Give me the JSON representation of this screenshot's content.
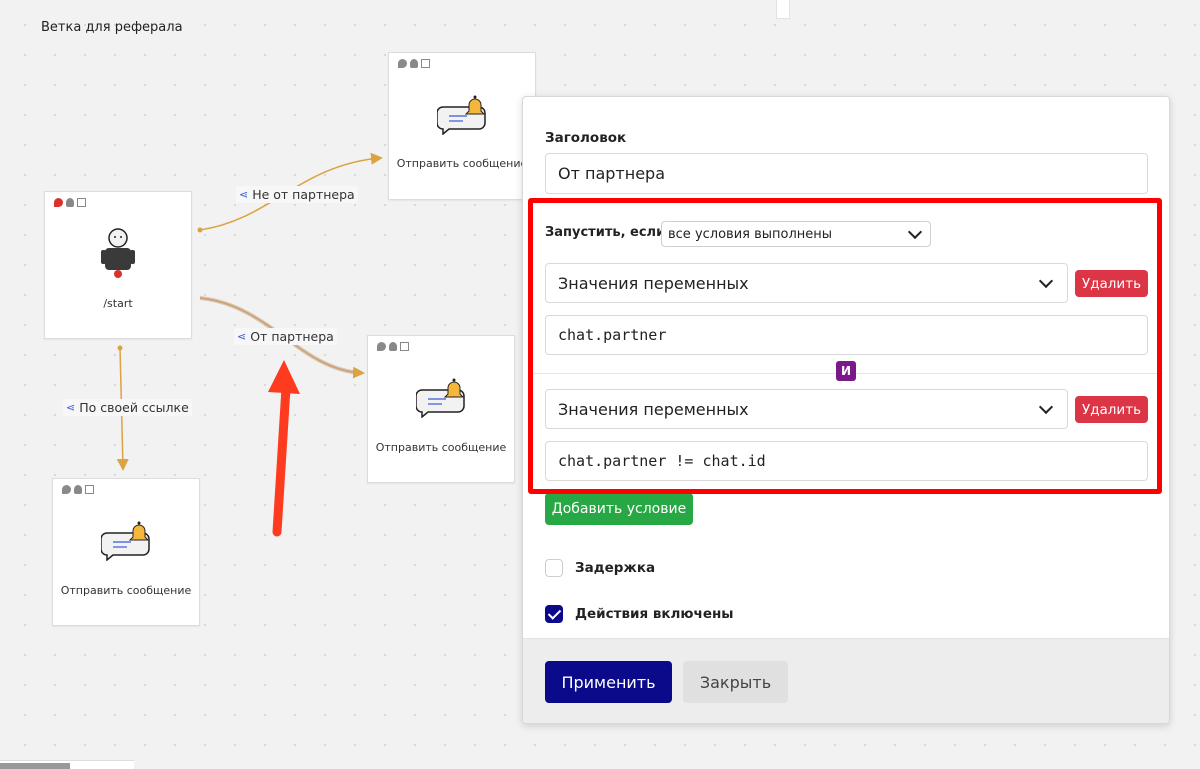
{
  "canvas": {
    "title": "Ветка для реферала",
    "nodes": {
      "start": {
        "label": "/start"
      },
      "msg_top": {
        "label": "Отправить сообщение"
      },
      "msg_mid": {
        "label": "Отправить сообщение"
      },
      "msg_bottom": {
        "label": "Отправить сообщение"
      }
    },
    "edges": {
      "not_partner": "Не от партнера",
      "partner": "От партнера",
      "own_link": "По своей ссылке"
    },
    "colors": {
      "edge": "#d9a441",
      "arrow": "#ff3b1f",
      "highlight": "#ff0000"
    }
  },
  "modal": {
    "title_label": "Заголовок",
    "title_value": "От партнера",
    "run_if_label": "Запустить, если",
    "run_if_value": "все условия выполнены",
    "conditions": [
      {
        "type": "Значения переменных",
        "expression": "chat.partner",
        "delete_label": "Удалить"
      },
      {
        "type": "Значения переменных",
        "expression": "chat.partner != chat.id",
        "delete_label": "Удалить"
      }
    ],
    "and_label": "И",
    "add_condition_label": "Добавить условие",
    "delay_label": "Задержка",
    "delay_checked": false,
    "actions_enabled_label": "Действия включены",
    "actions_enabled_checked": true,
    "apply_label": "Применить",
    "close_label": "Закрыть"
  }
}
